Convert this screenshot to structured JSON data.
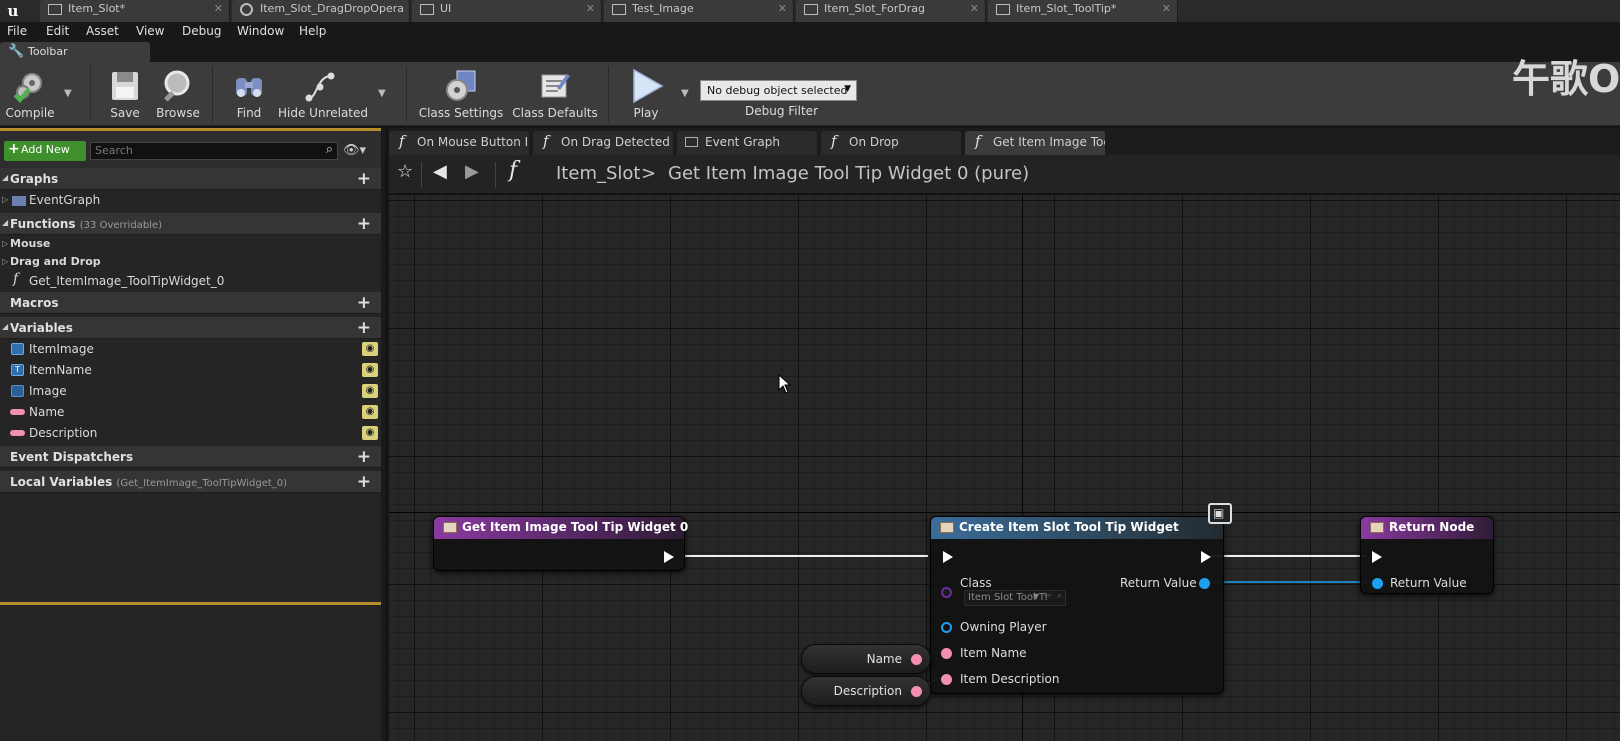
{
  "doc_tabs": [
    {
      "label": "Item_Slot*"
    },
    {
      "label": "Item_Slot_DragDropOpera"
    },
    {
      "label": "UI"
    },
    {
      "label": "Test_Image"
    },
    {
      "label": "Item_Slot_ForDrag"
    },
    {
      "label": "Item_Slot_ToolTip*"
    }
  ],
  "logo": "u",
  "menu": [
    "File",
    "Edit",
    "Asset",
    "View",
    "Debug",
    "Window",
    "Help"
  ],
  "toolbar_tab": "Toolbar",
  "toolbar": {
    "compile": "Compile",
    "save": "Save",
    "browse": "Browse",
    "find": "Find",
    "hide_unrelated": "Hide Unrelated",
    "class_settings": "Class Settings",
    "class_defaults": "Class Defaults",
    "play": "Play",
    "debug_select": "No debug object selected",
    "debug_filter": "Debug Filter"
  },
  "watermark": "午歌O",
  "my_blueprint": {
    "add_new": "Add New",
    "search_placeholder": "Search",
    "graphs": "Graphs",
    "event_graph": "EventGraph",
    "functions": "Functions",
    "functions_sub": "(33 Overridable)",
    "cat_mouse": "Mouse",
    "cat_drag": "Drag and Drop",
    "func_item": "Get_ItemImage_ToolTipWidget_0",
    "macros": "Macros",
    "variables": "Variables",
    "vars": [
      {
        "label": "ItemImage",
        "color": "#3f8cd6"
      },
      {
        "label": "ItemName",
        "color": "#3f8cd6"
      },
      {
        "label": "Image",
        "color": "#3f8cd6"
      },
      {
        "label": "Name",
        "color": "#f28fb3"
      },
      {
        "label": "Description",
        "color": "#f28fb3"
      }
    ],
    "event_dispatchers": "Event Dispatchers",
    "local_variables": "Local Variables",
    "local_variables_sub": "(Get_ItemImage_ToolTipWidget_0)"
  },
  "graph_tabs": [
    {
      "label": "On Mouse Button I"
    },
    {
      "label": "On Drag Detected"
    },
    {
      "label": "Event Graph"
    },
    {
      "label": "On Drop"
    },
    {
      "label": "Get Item Image Toc"
    }
  ],
  "breadcrumb": {
    "class": "Item_Slot",
    "sep": ">",
    "function": "Get Item Image Tool Tip Widget 0 (pure)"
  },
  "nodes": {
    "entry": {
      "title": "Get Item Image Tool Tip Widget 0"
    },
    "create": {
      "title": "Create Item Slot Tool Tip Widget",
      "class_label": "Class",
      "class_value": "Item Slot Tool Ti",
      "return_value": "Return Value",
      "owning_player": "Owning Player",
      "item_name": "Item Name",
      "item_description": "Item Description"
    },
    "return": {
      "title": "Return Node",
      "return_value": "Return Value"
    },
    "get_name": {
      "label": "Name"
    },
    "get_description": {
      "label": "Description"
    }
  },
  "colors": {
    "exec": "#ffffff",
    "object_pin": "#1ea0ef",
    "string_pin": "#f28fb3",
    "class_pin": "#6a2d9e",
    "accent": "#b58f2b",
    "add_new": "#3f8f2d"
  }
}
